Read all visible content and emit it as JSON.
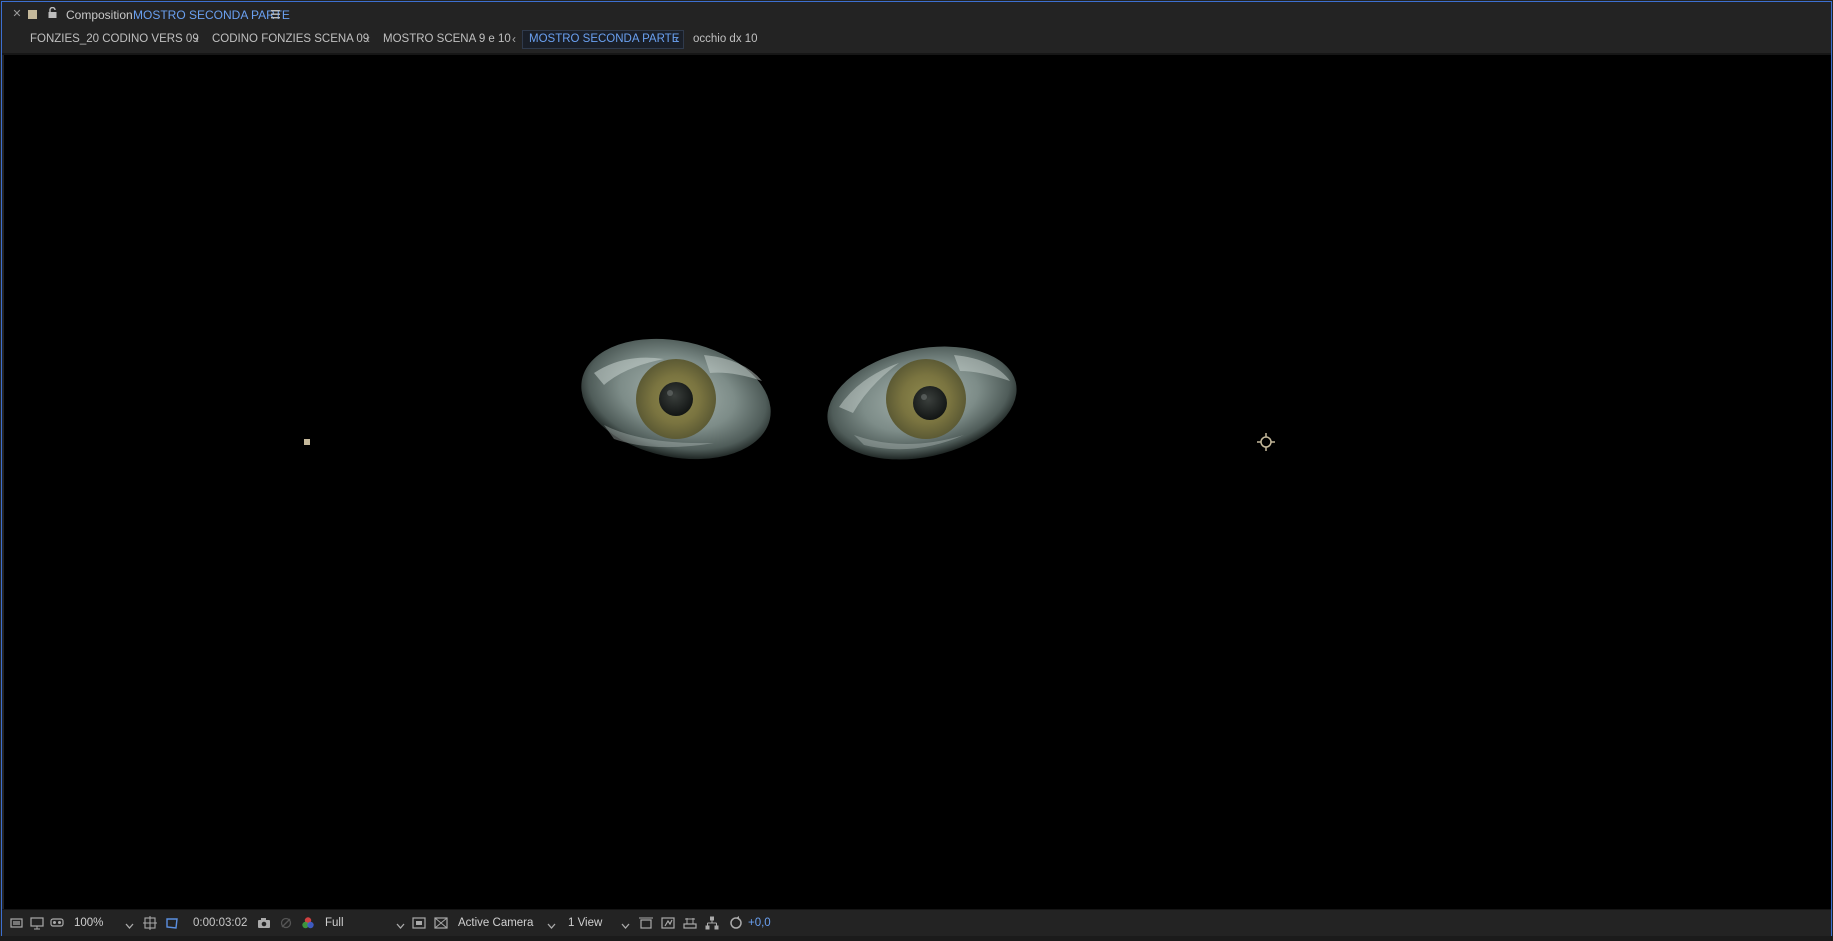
{
  "panel": {
    "title_prefix": "Composition",
    "title_name": "MOSTRO SECONDA PARTE"
  },
  "breadcrumbs": [
    {
      "label": "FONZIES_20 CODINO VERS 09",
      "active": false
    },
    {
      "label": "CODINO FONZIES SCENA 09",
      "active": false
    },
    {
      "label": "MOSTRO SCENA 9 e 10",
      "active": false
    },
    {
      "label": "MOSTRO SECONDA PARTE",
      "active": true
    },
    {
      "label": "occhio dx 10",
      "active": false
    }
  ],
  "toolbar": {
    "zoom": "100%",
    "timecode": "0:00:03:02",
    "resolution": "Full",
    "camera": "Active Camera",
    "views": "1 View",
    "exposure": "+0,0"
  },
  "colors": {
    "accent": "#6aa0f0",
    "panel_border": "#3c6fd0",
    "background": "#232323",
    "viewer": "#000000",
    "label_swatch": "#c4b89a"
  }
}
